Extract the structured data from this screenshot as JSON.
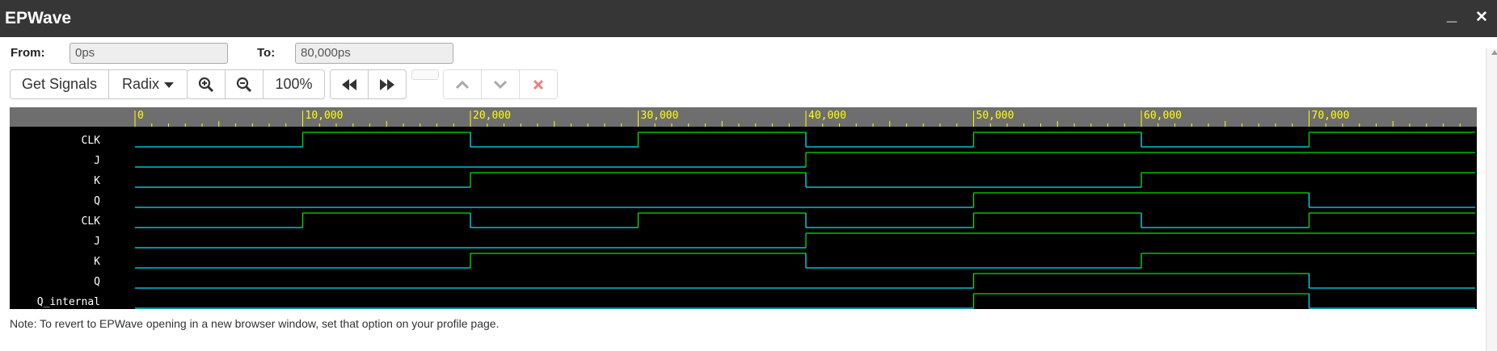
{
  "window": {
    "title": "EPWave",
    "minimize_glyph": "_",
    "close_glyph": "✕"
  },
  "range": {
    "from_label": "From:",
    "from_value": "0ps",
    "to_label": "To:",
    "to_value": "80,000ps"
  },
  "toolbar": {
    "get_signals": "Get Signals",
    "radix": "Radix",
    "zoom_level": "100%",
    "icons": [
      "zoom-in-icon",
      "zoom-out-icon",
      "rewind-icon",
      "fast-forward-icon",
      "chevron-up-icon",
      "chevron-down-icon",
      "close-icon"
    ]
  },
  "colors": {
    "header_bg": "#363636",
    "ruler_bg": "#6e6e6e",
    "ruler_text": "#ffff00",
    "wave_low": "#00e5ff",
    "wave_high": "#00e400",
    "wave_bg": "#000000",
    "signal_text": "#ffffff",
    "delete_icon": "#e53935"
  },
  "waveform": {
    "time_range": [
      0,
      80000
    ],
    "major_ticks": [
      0,
      10000,
      20000,
      30000,
      40000,
      50000,
      60000,
      70000
    ],
    "major_tick_labels": [
      "0",
      "10,000",
      "20,000",
      "30,000",
      "40,000",
      "50,000",
      "60,000",
      "70,000"
    ],
    "signals": [
      {
        "name": "CLK",
        "transitions": [
          [
            0,
            0
          ],
          [
            10000,
            1
          ],
          [
            20000,
            0
          ],
          [
            30000,
            1
          ],
          [
            40000,
            0
          ],
          [
            50000,
            1
          ],
          [
            60000,
            0
          ],
          [
            70000,
            1
          ]
        ]
      },
      {
        "name": "J",
        "transitions": [
          [
            0,
            0
          ],
          [
            40000,
            1
          ]
        ]
      },
      {
        "name": "K",
        "transitions": [
          [
            0,
            0
          ],
          [
            20000,
            1
          ],
          [
            40000,
            0
          ],
          [
            60000,
            1
          ]
        ]
      },
      {
        "name": "Q",
        "transitions": [
          [
            0,
            0
          ],
          [
            50000,
            1
          ],
          [
            70000,
            0
          ]
        ]
      },
      {
        "name": "CLK",
        "transitions": [
          [
            0,
            0
          ],
          [
            10000,
            1
          ],
          [
            20000,
            0
          ],
          [
            30000,
            1
          ],
          [
            40000,
            0
          ],
          [
            50000,
            1
          ],
          [
            60000,
            0
          ],
          [
            70000,
            1
          ]
        ]
      },
      {
        "name": "J",
        "transitions": [
          [
            0,
            0
          ],
          [
            40000,
            1
          ]
        ]
      },
      {
        "name": "K",
        "transitions": [
          [
            0,
            0
          ],
          [
            20000,
            1
          ],
          [
            40000,
            0
          ],
          [
            60000,
            1
          ]
        ]
      },
      {
        "name": "Q",
        "transitions": [
          [
            0,
            0
          ],
          [
            50000,
            1
          ],
          [
            70000,
            0
          ]
        ]
      },
      {
        "name": "Q_internal",
        "transitions": [
          [
            0,
            0
          ],
          [
            50000,
            1
          ],
          [
            70000,
            0
          ]
        ]
      }
    ]
  },
  "note": "Note: To revert to EPWave opening in a new browser window, set that option on your profile page."
}
